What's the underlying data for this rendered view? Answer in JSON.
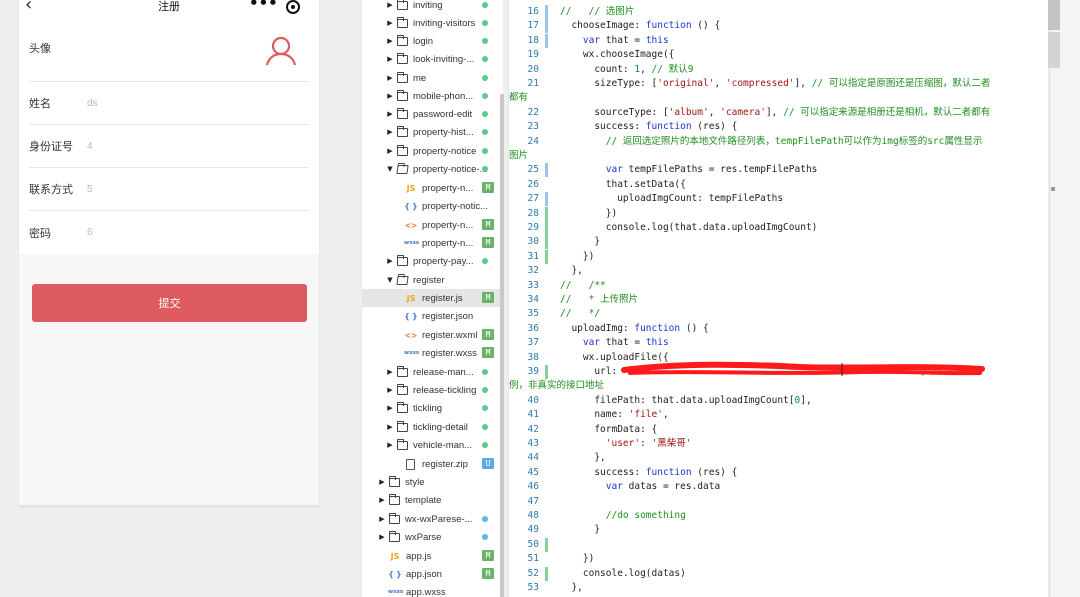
{
  "phone": {
    "nav": {
      "back_icon": "chevron-left",
      "title": "注册",
      "menu_icon": "more-dots",
      "capsule_icon": "record-target"
    },
    "fields": [
      {
        "label": "头像",
        "value": "",
        "icon": "user-avatar"
      },
      {
        "label": "姓名",
        "value": "ds"
      },
      {
        "label": "身份证号",
        "value": "4"
      },
      {
        "label": "联系方式",
        "value": "5"
      },
      {
        "label": "密码",
        "value": "6"
      }
    ],
    "submit_label": "提交",
    "accent_color": "#dd5b5f"
  },
  "tree": {
    "items": [
      {
        "kind": "folder",
        "name": "inviting",
        "status": "dot-green"
      },
      {
        "kind": "folder",
        "name": "inviting-visitors",
        "status": "dot-green"
      },
      {
        "kind": "folder",
        "name": "login",
        "status": "dot-green"
      },
      {
        "kind": "folder",
        "name": "look-inviting-...",
        "status": "dot-green"
      },
      {
        "kind": "folder",
        "name": "me",
        "status": "dot-green"
      },
      {
        "kind": "folder",
        "name": "mobile-phon...",
        "status": "dot-green"
      },
      {
        "kind": "folder",
        "name": "password-edit",
        "status": "dot-green"
      },
      {
        "kind": "folder",
        "name": "property-hist...",
        "status": "dot-green"
      },
      {
        "kind": "folder",
        "name": "property-notice",
        "status": "dot-green"
      },
      {
        "kind": "folder-open",
        "name": "property-notice-...",
        "status": "dot-green"
      },
      {
        "kind": "file",
        "icon": "js",
        "name": "property-n...",
        "status": "M"
      },
      {
        "kind": "file",
        "icon": "json",
        "name": "property-notic...",
        "status": ""
      },
      {
        "kind": "file",
        "icon": "wxml",
        "name": "property-n...",
        "status": "M"
      },
      {
        "kind": "file",
        "icon": "wxss",
        "name": "property-n...",
        "status": "M"
      },
      {
        "kind": "folder",
        "name": "property-pay...",
        "status": "dot-green"
      },
      {
        "kind": "folder-open",
        "name": "register",
        "status": ""
      },
      {
        "kind": "file",
        "icon": "js",
        "name": "register.js",
        "status": "M",
        "selected": true
      },
      {
        "kind": "file",
        "icon": "json",
        "name": "register.json",
        "status": ""
      },
      {
        "kind": "file",
        "icon": "wxml",
        "name": "register.wxml",
        "status": "M"
      },
      {
        "kind": "file",
        "icon": "wxss",
        "name": "register.wxss",
        "status": "M"
      },
      {
        "kind": "folder",
        "name": "release-man...",
        "status": "dot-green"
      },
      {
        "kind": "folder",
        "name": "release-tickling",
        "status": "dot-green"
      },
      {
        "kind": "folder",
        "name": "tickling",
        "status": "dot-green"
      },
      {
        "kind": "folder",
        "name": "tickling-detail",
        "status": "dot-green"
      },
      {
        "kind": "folder",
        "name": "vehicle-man...",
        "status": "dot-green"
      },
      {
        "kind": "file",
        "icon": "zip",
        "name": "register.zip",
        "status": "U"
      },
      {
        "kind": "root-folder",
        "name": "style",
        "status": ""
      },
      {
        "kind": "root-folder",
        "name": "template",
        "status": ""
      },
      {
        "kind": "root-folder",
        "name": "wx-wxParese-...",
        "status": "dot-blue"
      },
      {
        "kind": "root-folder",
        "name": "wxParse",
        "status": "dot-blue"
      },
      {
        "kind": "root-file",
        "icon": "js",
        "name": "app.js",
        "status": "M"
      },
      {
        "kind": "root-file",
        "icon": "json",
        "name": "app.json",
        "status": "M"
      },
      {
        "kind": "root-file",
        "icon": "wxss",
        "name": "app.wxss",
        "status": ""
      }
    ],
    "icon_labels": {
      "js": "JS",
      "json": "{ }",
      "wxml": "<>",
      "wxss": "wxss"
    }
  },
  "editor": {
    "lines": [
      {
        "n": "16",
        "code": "//   // 选图片"
      },
      {
        "n": "17",
        "code": "  chooseImage: function () {"
      },
      {
        "n": "18",
        "code": "    var that = this"
      },
      {
        "n": "19",
        "code": "    wx.chooseImage({"
      },
      {
        "n": "20",
        "code": "      count: 1, // 默认9"
      },
      {
        "n": "21",
        "code": "      sizeType: ['original', 'compressed'], // 可以指定是原图还是压缩图，默认二者"
      },
      {
        "n": "",
        "code": "都有"
      },
      {
        "n": "22",
        "code": "      sourceType: ['album', 'camera'], // 可以指定来源是相册还是相机，默认二者都有"
      },
      {
        "n": "23",
        "code": "      success: function (res) {"
      },
      {
        "n": "24",
        "code": "        // 返回选定照片的本地文件路径列表，tempFilePath可以作为img标签的src属性显示"
      },
      {
        "n": "",
        "code": "图片"
      },
      {
        "n": "25",
        "code": "        var tempFilePaths = res.tempFilePaths"
      },
      {
        "n": "26",
        "code": "        that.setData({"
      },
      {
        "n": "27",
        "code": "          uploadImgCount: tempFilePaths"
      },
      {
        "n": "28",
        "code": "        })"
      },
      {
        "n": "29",
        "code": "        console.log(that.data.uploadImgCount)"
      },
      {
        "n": "30",
        "code": "      }"
      },
      {
        "n": "31",
        "code": "    })"
      },
      {
        "n": "32",
        "code": "  },"
      },
      {
        "n": "33",
        "code": "//   /**"
      },
      {
        "n": "34",
        "code": "//   * 上传照片"
      },
      {
        "n": "35",
        "code": "//   */"
      },
      {
        "n": "36",
        "code": "  uploadImg: function () {"
      },
      {
        "n": "37",
        "code": "    var that = this"
      },
      {
        "n": "38",
        "code": "    wx.uploadFile({"
      },
      {
        "n": "39",
        "code": "      url: '                                                  ', //仅为示"
      },
      {
        "n": "",
        "code": "例，非真实的接口地址"
      },
      {
        "n": "40",
        "code": "      filePath: that.data.uploadImgCount[0],"
      },
      {
        "n": "41",
        "code": "      name: 'file',"
      },
      {
        "n": "42",
        "code": "      formData: {"
      },
      {
        "n": "43",
        "code": "        'user': '黑柴哥'"
      },
      {
        "n": "44",
        "code": "      },"
      },
      {
        "n": "45",
        "code": "      success: function (res) {"
      },
      {
        "n": "46",
        "code": "        var datas = res.data"
      },
      {
        "n": "47",
        "code": ""
      },
      {
        "n": "48",
        "code": "        //do something"
      },
      {
        "n": "49",
        "code": "      }"
      },
      {
        "n": "50",
        "code": ""
      },
      {
        "n": "51",
        "code": "    })"
      },
      {
        "n": "52",
        "code": "    console.log(datas)"
      },
      {
        "n": "53",
        "code": "  },"
      }
    ]
  }
}
